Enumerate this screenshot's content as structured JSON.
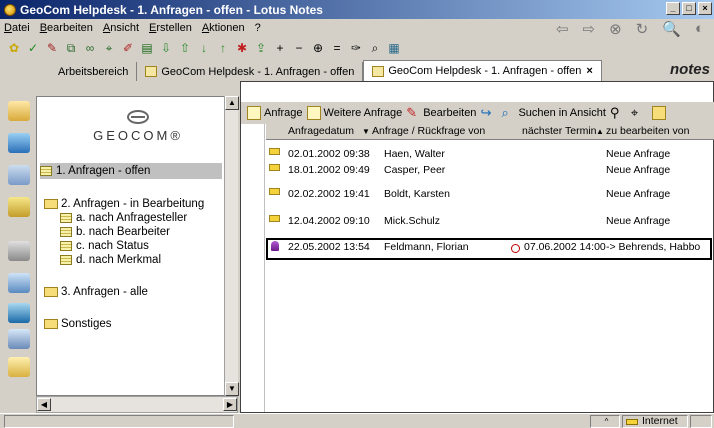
{
  "window": {
    "title": "GeoCom Helpdesk - 1. Anfragen - offen - Lotus Notes"
  },
  "menu": [
    "Datei",
    "Bearbeiten",
    "Ansicht",
    "Erstellen",
    "Aktionen",
    "?"
  ],
  "tabs": [
    {
      "label": "Arbeitsbereich"
    },
    {
      "label": "GeoCom Helpdesk - 1. Anfragen - offen"
    },
    {
      "label": "GeoCom Helpdesk - 1. Anfragen - offen",
      "active": true
    }
  ],
  "brand": "notes",
  "logo_text": "GEOCOM®",
  "navigator": {
    "items": [
      {
        "label": "1. Anfragen - offen"
      },
      {
        "label": "2. Anfragen - in Bearbeitung"
      },
      {
        "label": "a. nach Anfragesteller"
      },
      {
        "label": "b. nach Bearbeiter"
      },
      {
        "label": "c. nach Status"
      },
      {
        "label": "d. nach Merkmal"
      },
      {
        "label": "3. Anfragen - alle"
      },
      {
        "label": "Sonstiges"
      }
    ]
  },
  "actions": [
    "Anfrage",
    "Weitere Anfrage",
    "Bearbeiten",
    "Suchen in Ansicht"
  ],
  "columns": [
    "Anfragedatum",
    "Anfrage / Rückfrage von",
    "nächster Termin",
    "zu bearbeiten von"
  ],
  "rows": [
    {
      "date": "02.01.2002 09:38",
      "from": "Haen, Walter",
      "next": "",
      "assignee": "Neue Anfrage"
    },
    {
      "date": "18.01.2002 09:49",
      "from": "Casper, Peer",
      "next": "",
      "assignee": "Neue Anfrage"
    },
    {
      "date": "02.02.2002 19:41",
      "from": "Boldt, Karsten",
      "next": "",
      "assignee": "Neue Anfrage"
    },
    {
      "date": "12.04.2002 09:10",
      "from": "Mick.Schulz",
      "next": "",
      "assignee": "Neue Anfrage"
    },
    {
      "date": "22.05.2002 13:54",
      "from": "Feldmann, Florian",
      "next": "07.06.2002 14:00",
      "assignee": "-> Behrends, Habbo"
    }
  ],
  "status": {
    "location": "Internet"
  }
}
